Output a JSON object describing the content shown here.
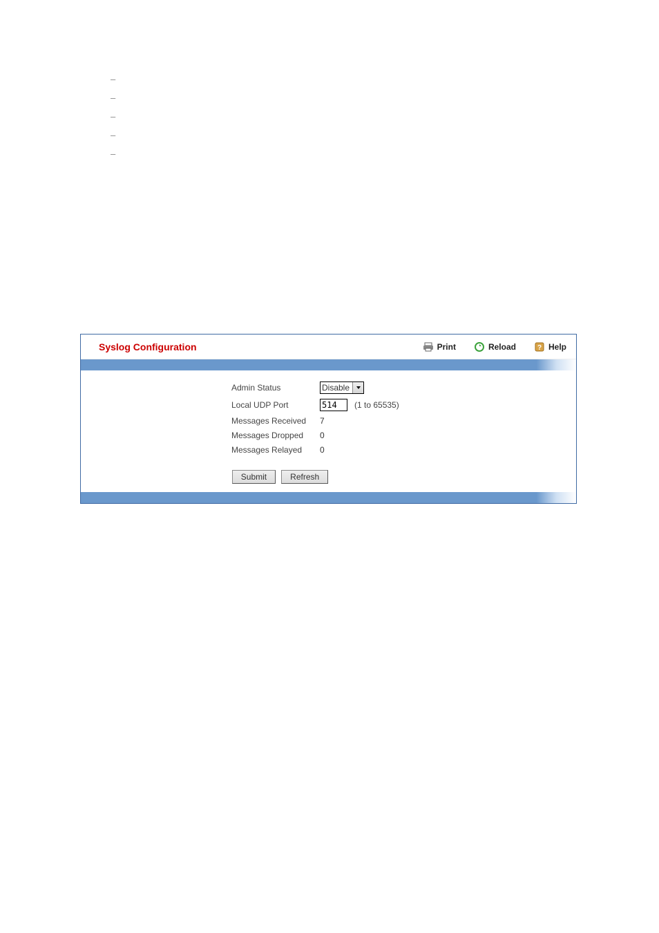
{
  "header": {
    "title": "Syslog Configuration",
    "tools": {
      "print": "Print",
      "reload": "Reload",
      "help": "Help"
    }
  },
  "form": {
    "admin_status": {
      "label": "Admin Status",
      "value": "Disable"
    },
    "local_udp_port": {
      "label": "Local UDP Port",
      "value": "514",
      "hint": "(1 to 65535)"
    },
    "messages_received": {
      "label": "Messages Received",
      "value": "7"
    },
    "messages_dropped": {
      "label": "Messages Dropped",
      "value": "0"
    },
    "messages_relayed": {
      "label": "Messages Relayed",
      "value": "0"
    }
  },
  "buttons": {
    "submit": "Submit",
    "refresh": "Refresh"
  },
  "dashes": [
    "–",
    "–",
    "–",
    "–",
    "–"
  ]
}
